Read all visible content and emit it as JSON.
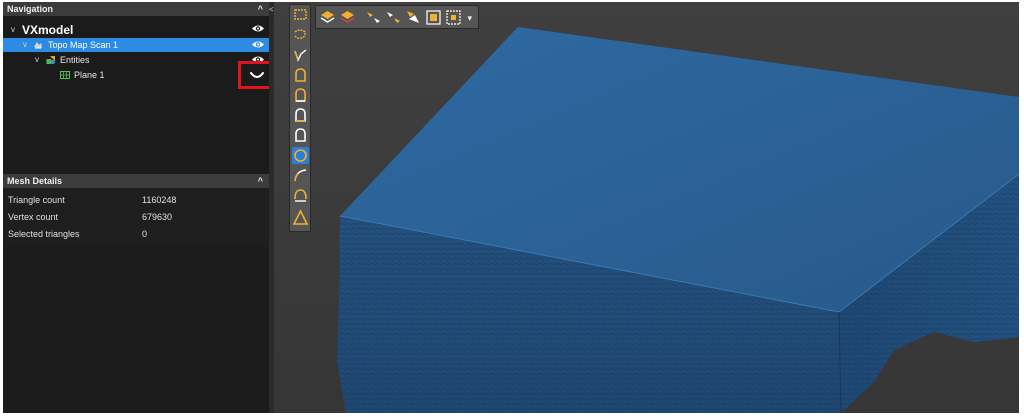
{
  "navigation": {
    "title": "Navigation",
    "collapse_glyph": "^",
    "tree": {
      "root": {
        "label": "VXmodel",
        "chevron": "v",
        "icon": "eye-icon"
      },
      "scan": {
        "label": "Topo Map Scan 1",
        "chevron": "v",
        "icon": "scan-icon",
        "visibility": "eye-icon"
      },
      "entities": {
        "label": "Entities",
        "chevron": "v",
        "icon": "entities-icon",
        "visibility": "eye-icon"
      },
      "plane": {
        "label": "Plane 1",
        "icon": "plane-grid-icon",
        "visibility": "hidden-eye-icon"
      }
    },
    "highlight_color": "#e0141e",
    "selection_color": "#2e8be3"
  },
  "mesh_details": {
    "title": "Mesh Details",
    "collapse_glyph": "^",
    "rows": [
      {
        "key": "Triangle count",
        "value": "1160248"
      },
      {
        "key": "Vertex count",
        "value": "679630"
      },
      {
        "key": "Selected triangles",
        "value": "0"
      }
    ]
  },
  "splitter": {
    "glyph": "<"
  },
  "viewport": {
    "model_color": "#2b5f93",
    "vertical_tools": [
      "rectangle-select-icon",
      "lasso-select-icon",
      "freehand-line-select-icon",
      "surface-select-icon",
      "surface-select-inner-icon",
      "surface-select-outer-icon",
      "surface-select-outline-icon",
      "circle-select-icon",
      "curve-select-icon",
      "arc-select-icon",
      "triangle-select-icon"
    ],
    "active_tool": "circle-select-icon",
    "horizontal_tools": [
      "layers-icon",
      "layers-remove-icon",
      "select-through-icon",
      "select-visible-icon",
      "invert-selection-icon",
      "select-all-icon",
      "grow-selection-icon"
    ],
    "more_glyph": "▾"
  }
}
